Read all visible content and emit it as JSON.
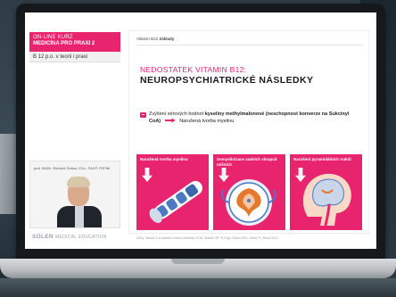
{
  "left_panel": {
    "course_line1": "ON-LINE KURZ",
    "course_line2": "MEDICÍNA PRO PRAXI 2",
    "lecture": "B 12 p.o. v teorii i praxi",
    "speaker_name": "prof. MUDr. Richard Češka, CSc., FACP, FEFIM",
    "logo_main": "SOLEN",
    "logo_sub": "MEDICAL EDUCATION"
  },
  "slide": {
    "header_prefix": "Vitamin B12",
    "header_bold": "Základy",
    "title1": "NEDOSTATEK VITAMIN B12:",
    "title2": "NEUROPSYCHIATRICKÉ NÁSLEDKY",
    "bullet_pre": "Zvýšení sérových hodnot",
    "bullet_kw": "kyseliny methylmalonové (neschopnost konverze na Sukcinyl CoA)",
    "bullet_post": "Narušená tvorba myelinu",
    "cards": [
      {
        "title": "Narušená tvorba myelinu"
      },
      {
        "title": "Demyelinizace zadních sloupců míšních"
      },
      {
        "title": "Narušení pyramidálních traktů"
      }
    ],
    "footer": "Zdroj: Herold G a kolektiv; Interní lékařství 2016; Stabler SP; N Engl J Med 2013; Green R; Blood 2017."
  },
  "colors": {
    "accent": "#e8246e",
    "dark": "#16191c"
  }
}
